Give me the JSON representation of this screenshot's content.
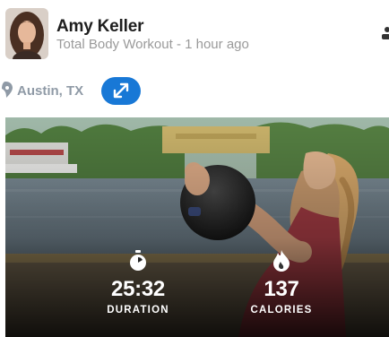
{
  "post": {
    "user_name": "Amy Keller",
    "subtitle": "Total Body Workout - 1 hour ago",
    "location": "Austin, TX"
  },
  "stats": [
    {
      "value": "25:32",
      "label": "DURATION",
      "icon": "stopwatch-icon"
    },
    {
      "value": "137",
      "label": "CALORIES",
      "icon": "flame-icon"
    }
  ],
  "colors": {
    "accent": "#1878d6",
    "name": "#1e1e1e",
    "subtitle": "#9a9a9a",
    "location": "#8f9aa6"
  }
}
